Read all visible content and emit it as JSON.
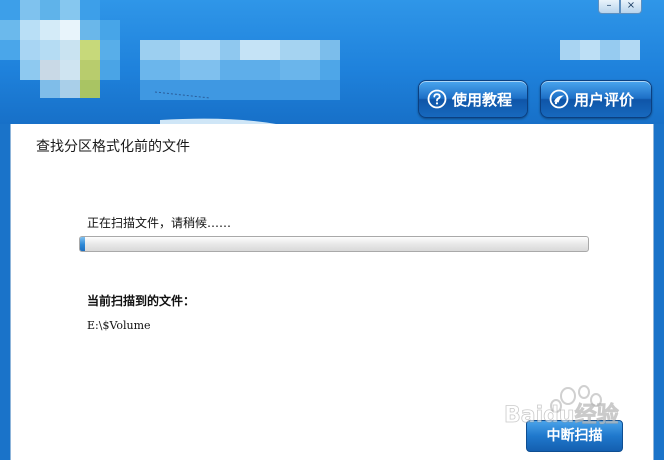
{
  "window": {
    "minimize_glyph": "–",
    "close_glyph": "×"
  },
  "header": {
    "help_button": {
      "label": "使用教程",
      "icon": "question-circle-icon"
    },
    "review_button": {
      "label": "用户评价",
      "icon": "feedback-badge-icon"
    }
  },
  "panel": {
    "title": "查找分区格式化前的文件",
    "status_text": "正在扫描文件，请稍候……",
    "progress_fraction": 0.01,
    "current_label": "当前扫描到的文件：",
    "current_path": "E:\\$Volume",
    "stop_button": "中断扫描"
  },
  "watermark": {
    "text": "Baidu经验"
  },
  "colors": {
    "header": "#1f82dc",
    "button": "#1d6fc6",
    "panel": "#ffffff",
    "progress": "#2d88d6"
  }
}
